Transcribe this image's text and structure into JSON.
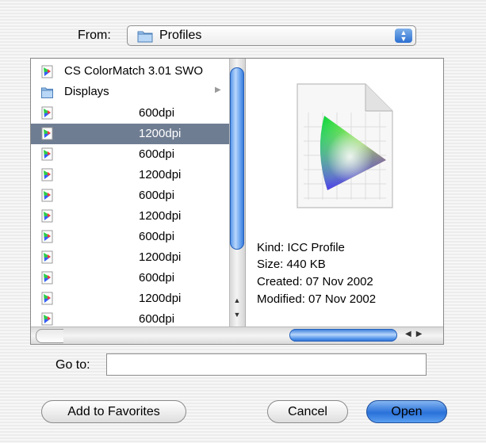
{
  "from": {
    "label": "From:",
    "folder": "Profiles",
    "folder_icon": "folder-icon",
    "arrows_icon": "popup-arrows-icon"
  },
  "browser": {
    "items": [
      {
        "name": "CS ColorMatch 3.01 SWO",
        "icon": "profile-icon",
        "kind": "name"
      },
      {
        "name": "Displays",
        "icon": "folder-icon",
        "kind": "name",
        "disclosure": "▶"
      },
      {
        "name": "600dpi",
        "icon": "profile-icon",
        "kind": "dpi"
      },
      {
        "name": "1200dpi",
        "icon": "profile-icon",
        "kind": "dpi",
        "selected": true
      },
      {
        "name": "600dpi",
        "icon": "profile-icon",
        "kind": "dpi"
      },
      {
        "name": "1200dpi",
        "icon": "profile-icon",
        "kind": "dpi"
      },
      {
        "name": "600dpi",
        "icon": "profile-icon",
        "kind": "dpi"
      },
      {
        "name": "1200dpi",
        "icon": "profile-icon",
        "kind": "dpi"
      },
      {
        "name": "600dpi",
        "icon": "profile-icon",
        "kind": "dpi"
      },
      {
        "name": "1200dpi",
        "icon": "profile-icon",
        "kind": "dpi"
      },
      {
        "name": "600dpi",
        "icon": "profile-icon",
        "kind": "dpi"
      },
      {
        "name": "1200dpi",
        "icon": "profile-icon",
        "kind": "dpi"
      },
      {
        "name": "600dpi",
        "icon": "profile-icon",
        "kind": "dpi"
      }
    ],
    "preview": {
      "icon": "icc-profile-document-icon",
      "kind": "Kind: ICC Profile",
      "size": "Size: 440 KB",
      "created": "Created: 07 Nov 2002",
      "modified": "Modified: 07 Nov 2002"
    }
  },
  "goto": {
    "label": "Go to:",
    "value": "",
    "placeholder": ""
  },
  "buttons": {
    "favorites": "Add to Favorites",
    "cancel": "Cancel",
    "open": "Open"
  },
  "colors": {
    "selection": "#6f7d92",
    "accent_blue": "#2a71d9"
  }
}
